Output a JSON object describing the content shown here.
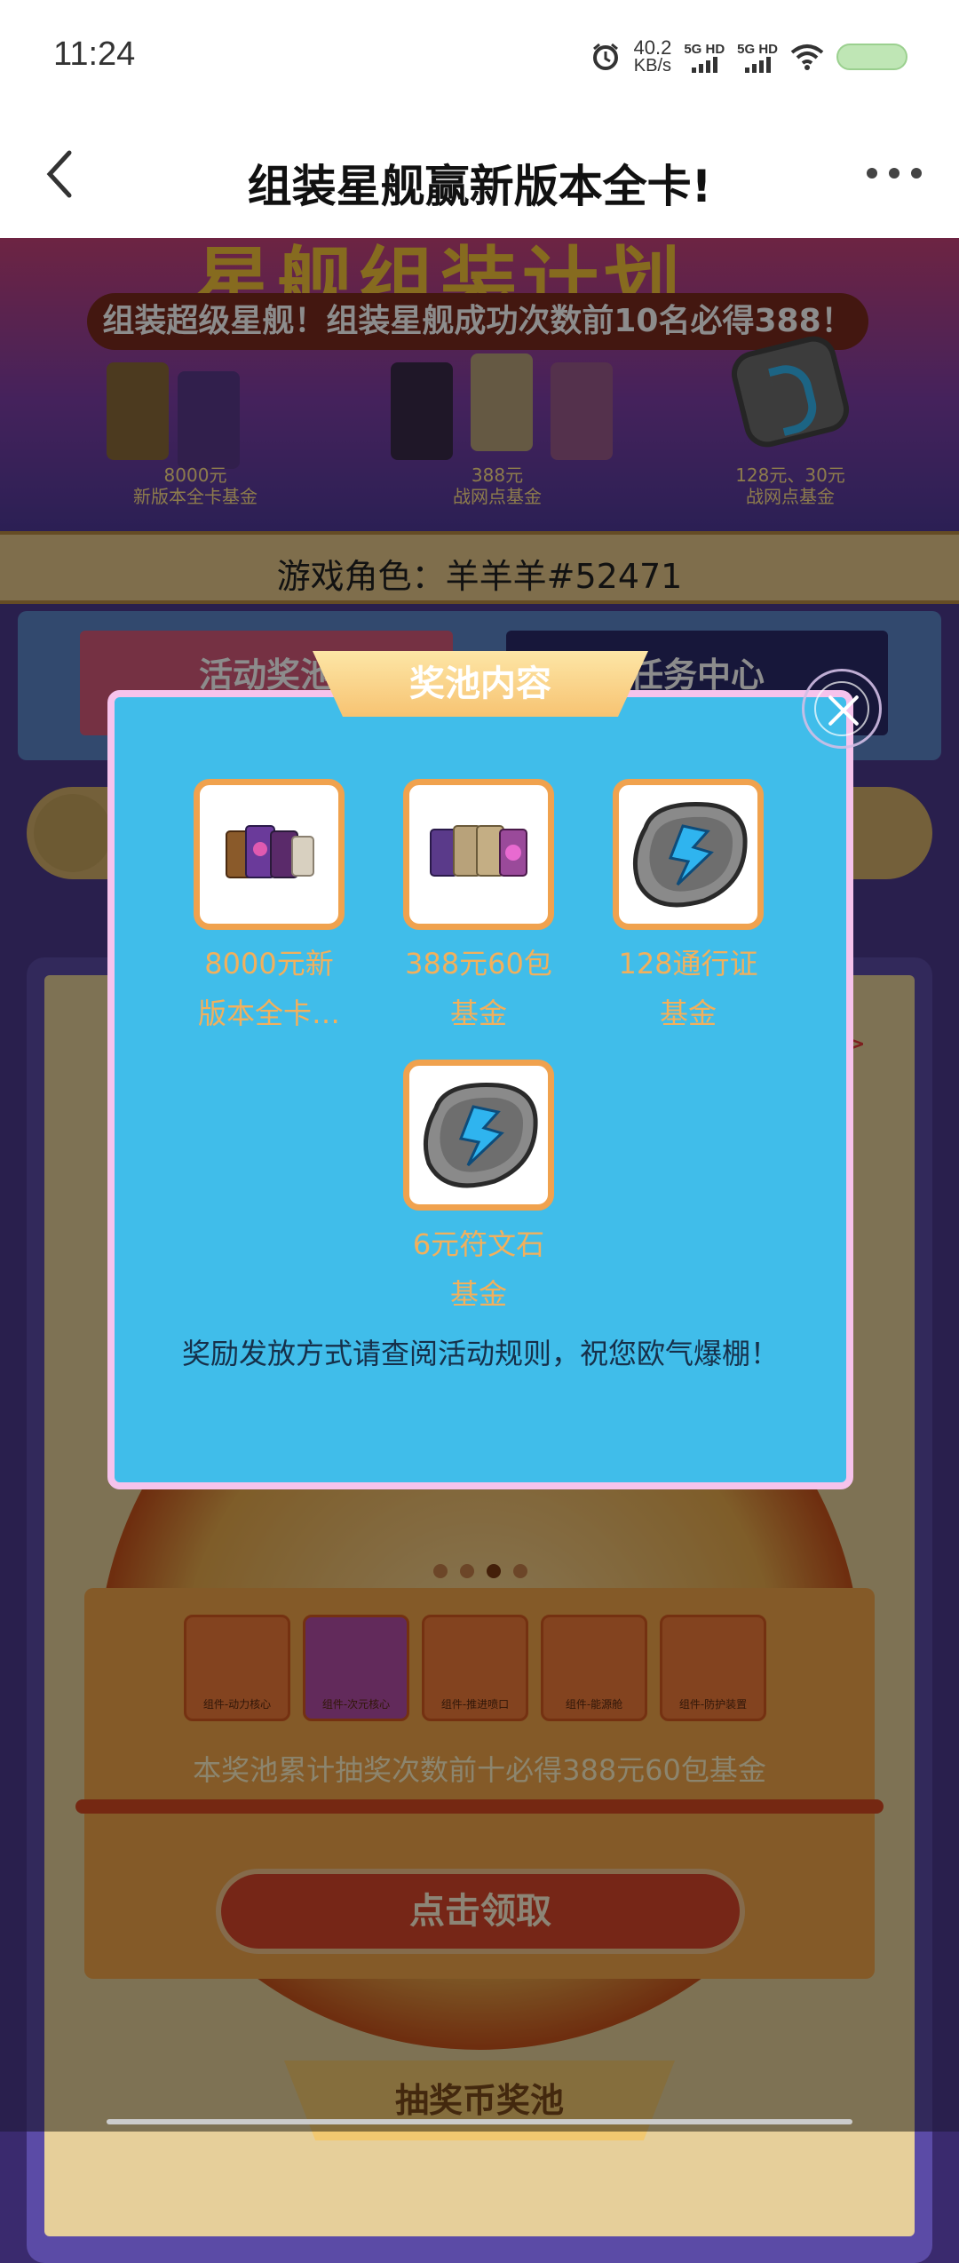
{
  "status_bar": {
    "time": "11:24",
    "net_speed_value": "40.2",
    "net_speed_unit": "KB/s",
    "signal1_label": "5G HD",
    "signal2_label": "5G HD",
    "icons": [
      "alarm-icon",
      "wifi-icon",
      "battery-icon"
    ]
  },
  "nav": {
    "title": "组装星舰赢新版本全卡!"
  },
  "background": {
    "banner_title": "星舰组装计划",
    "banner_subtitle": "组装超级星舰！组装星舰成功次数前10名必得388！",
    "banner_prizes": [
      {
        "line1": "8000元",
        "line2": "新版本全卡基金"
      },
      {
        "line1": "388元",
        "line2": "战网点基金"
      },
      {
        "line1": "128元、30元",
        "line2": "战网点基金"
      }
    ],
    "role_label": "游戏角色：羊羊羊#52471",
    "tab_left": "活动奖池",
    "tab_right": "任务中心",
    "arrow": ">",
    "items": [
      {
        "caption": "组件-动力核心"
      },
      {
        "caption": "组件-次元核心"
      },
      {
        "caption": "组件-推进喷口"
      },
      {
        "caption": "组件-能源舱"
      },
      {
        "caption": "组件-防护装置"
      }
    ],
    "pool_note": "本奖池累计抽奖次数前十必得388元60包基金",
    "claim_button": "点击领取",
    "pool_tab": "抽奖币奖池"
  },
  "modal": {
    "title": "奖池内容",
    "rewards": [
      {
        "line1": "8000元新",
        "line2": "版本全卡…",
        "icon": "card-pack-icon"
      },
      {
        "line1": "388元60包",
        "line2": "基金",
        "icon": "card-pack-icon"
      },
      {
        "line1": "128通行证",
        "line2": "基金",
        "icon": "rune-stone-icon"
      },
      {
        "line1": "6元符文石",
        "line2": "基金",
        "icon": "rune-stone-icon"
      }
    ],
    "note": "奖励发放方式请查阅活动规则，祝您欧气爆棚！"
  },
  "colors": {
    "modal_bg": "#40bdea",
    "modal_border": "#f6c3ec",
    "reward_border": "#f0a24e",
    "reward_text": "#f2b05c"
  }
}
